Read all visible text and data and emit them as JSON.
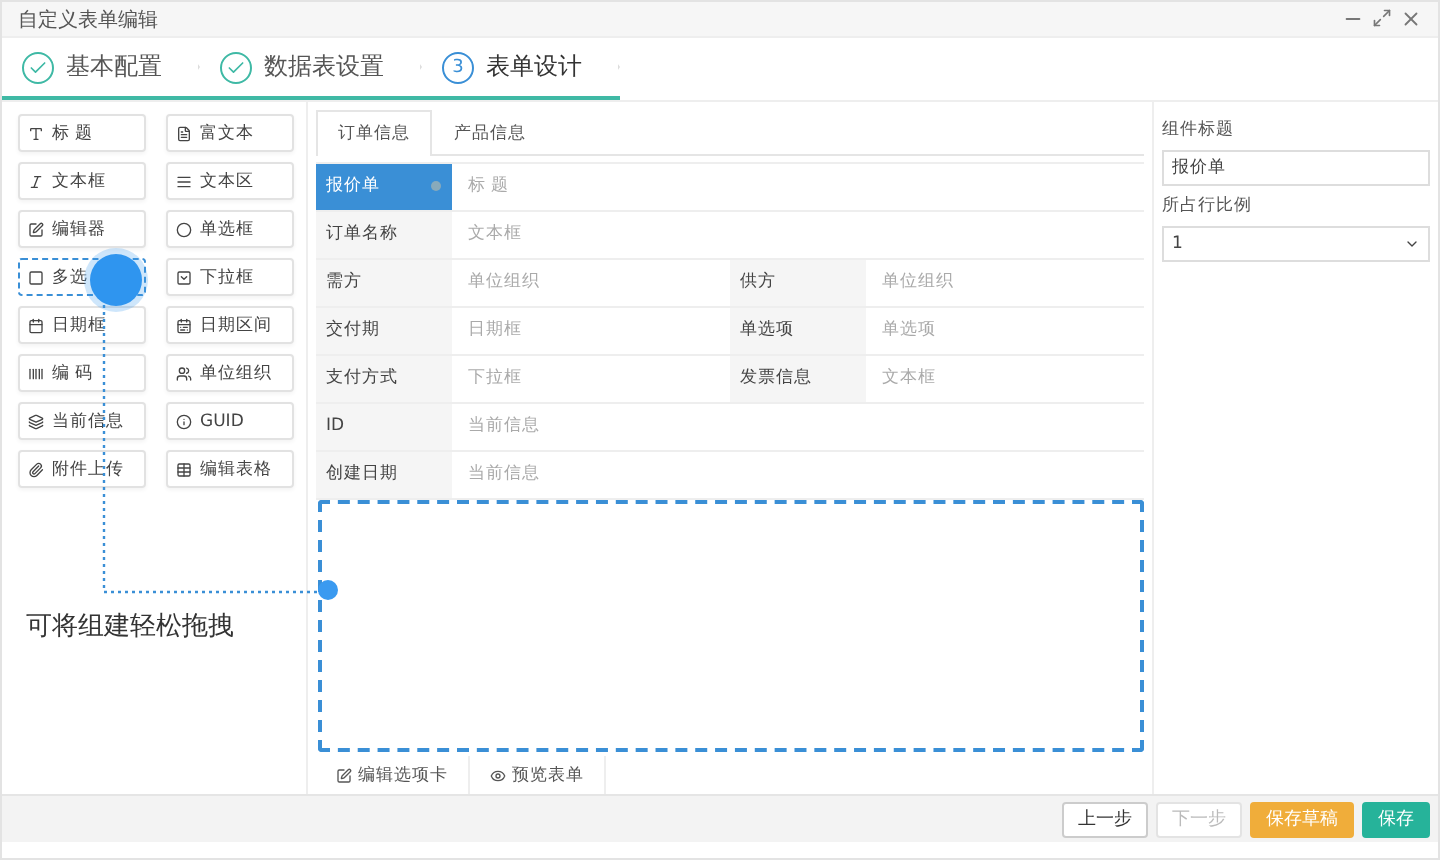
{
  "window": {
    "title": "自定义表单编辑"
  },
  "steps": [
    {
      "label": "基本配置",
      "done": true,
      "selected": false
    },
    {
      "label": "数据表设置",
      "done": true,
      "selected": false
    },
    {
      "label": "表单设计",
      "done": false,
      "number": "3",
      "selected": true
    }
  ],
  "palette": [
    {
      "label": "标 题",
      "dragging": false
    },
    {
      "label": "富文本",
      "dragging": false
    },
    {
      "label": "文本框",
      "dragging": false
    },
    {
      "label": "文本区",
      "dragging": false
    },
    {
      "label": "编辑器",
      "dragging": false
    },
    {
      "label": "单选框",
      "dragging": false
    },
    {
      "label": "多选",
      "dragging": true
    },
    {
      "label": "下拉框",
      "dragging": false
    },
    {
      "label": "日期框",
      "dragging": false
    },
    {
      "label": "日期区间",
      "dragging": false
    },
    {
      "label": "编 码",
      "dragging": false
    },
    {
      "label": "单位组织",
      "dragging": false
    },
    {
      "label": "当前信息",
      "dragging": false
    },
    {
      "label": "GUID",
      "dragging": false
    },
    {
      "label": "附件上传",
      "dragging": false
    },
    {
      "label": "编辑表格",
      "dragging": false
    }
  ],
  "hint": "可将组建轻松拖拽",
  "form_tabs": [
    {
      "label": "订单信息",
      "selected": true
    },
    {
      "label": "产品信息",
      "selected": false
    }
  ],
  "form_rows": [
    {
      "cells": [
        {
          "label": "报价单",
          "value": "标 题",
          "selected": true
        }
      ]
    },
    {
      "cells": [
        {
          "label": "订单名称",
          "value": "文本框",
          "selected": false
        }
      ]
    },
    {
      "cells": [
        {
          "label": "需方",
          "value": "单位组织",
          "selected": false
        },
        {
          "label": "供方",
          "value": "单位组织",
          "selected": false
        }
      ]
    },
    {
      "cells": [
        {
          "label": "交付期",
          "value": "日期框",
          "selected": false
        },
        {
          "label": "单选项",
          "value": "单选项",
          "selected": false
        }
      ]
    },
    {
      "cells": [
        {
          "label": "支付方式",
          "value": "下拉框",
          "selected": false
        },
        {
          "label": "发票信息",
          "value": "文本框",
          "selected": false
        }
      ]
    },
    {
      "cells": [
        {
          "label": "ID",
          "value": "当前信息",
          "selected": false
        }
      ]
    },
    {
      "cells": [
        {
          "label": "创建日期",
          "value": "当前信息",
          "selected": false
        }
      ]
    }
  ],
  "bottom_tabs": [
    {
      "label": "编辑选项卡"
    },
    {
      "label": "预览表单"
    }
  ],
  "properties": {
    "title_label": "组件标题",
    "title_value": "报价单",
    "ratio_label": "所占行比例",
    "ratio_value": "1"
  },
  "footer_buttons": [
    {
      "label": "上一步",
      "kind": "default"
    },
    {
      "label": "下一步",
      "kind": "disabled"
    },
    {
      "label": "保存草稿",
      "kind": "warning"
    },
    {
      "label": "保存",
      "kind": "primary"
    }
  ]
}
